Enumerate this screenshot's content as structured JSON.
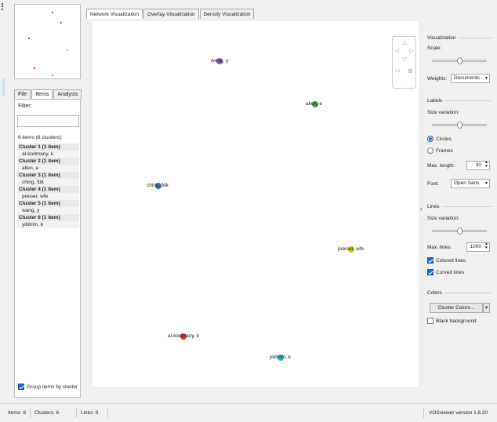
{
  "left": {
    "tabs": [
      "File",
      "Items",
      "Analysis"
    ],
    "filter_label": "Filter:",
    "filter_value": "",
    "summary": "6 items (6 clusters):",
    "clusters": [
      {
        "title": "Cluster 1 (1 item)",
        "items": [
          "al-kodmany, k"
        ]
      },
      {
        "title": "Cluster 2 (1 item)",
        "items": [
          "allen, e"
        ]
      },
      {
        "title": "Cluster 3 (1 item)",
        "items": [
          "ching, fdk"
        ]
      },
      {
        "title": "Cluster 4 (1 item)",
        "items": [
          "preiser, wfe"
        ]
      },
      {
        "title": "Cluster 5 (1 item)",
        "items": [
          "wang, y"
        ]
      },
      {
        "title": "Cluster 6 (1 item)",
        "items": [
          "yildirim, k"
        ]
      }
    ],
    "group_by_cluster_label": "Group items by cluster",
    "group_by_cluster_checked": true
  },
  "main_tabs": [
    "Network Visualization",
    "Overlay Visualization",
    "Density Visualization"
  ],
  "active_main_tab": 0,
  "network": {
    "nodes": [
      {
        "label": "wang, y",
        "color": "#8a5cb8"
      },
      {
        "label": "allen, e",
        "color": "#3aa84b"
      },
      {
        "label": "ching, fdk",
        "color": "#3a78c2"
      },
      {
        "label": "preiser, wfe",
        "color": "#d6c41c"
      },
      {
        "label": "al-kodmany, k",
        "color": "#d23a3a"
      },
      {
        "label": "yildirim, k",
        "color": "#36b3c9"
      }
    ]
  },
  "right": {
    "visualization_title": "Visualization",
    "scale_label": "Scale:",
    "scale_value": 0.5,
    "weights_label": "Weights:",
    "weights_value": "Documents",
    "labels_title": "Labels",
    "size_variation_label": "Size variation:",
    "labels_size_variation": 0.5,
    "circles_label": "Circles",
    "frames_label": "Frames",
    "circles_selected": true,
    "max_length_label": "Max. length:",
    "max_length_value": "30",
    "font_label": "Font:",
    "font_value": "Open Sans",
    "lines_title": "Lines",
    "lines_size_variation_label": "Size variation:",
    "lines_size_variation": 0.5,
    "max_lines_label": "Max. lines:",
    "max_lines_value": "1000",
    "colored_lines_label": "Colored lines",
    "curved_lines_label": "Curved lines",
    "colors_title": "Colors",
    "cluster_colors_button": "Cluster Colors...",
    "black_background_label": "Black background"
  },
  "status": {
    "items": "Items: 6",
    "clusters": "Clusters: 6",
    "links": "Links: 0",
    "version": "VOSviewer version 1.6.20"
  }
}
